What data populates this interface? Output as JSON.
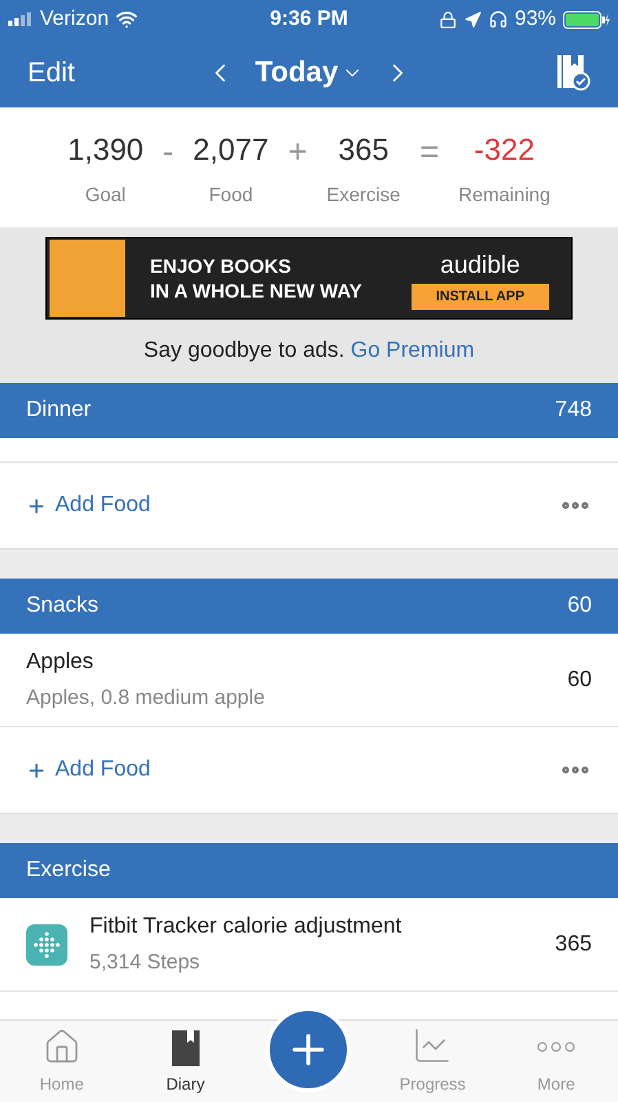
{
  "status_bar": {
    "carrier": "Verizon",
    "time": "9:36 PM",
    "battery": "93%"
  },
  "nav": {
    "edit": "Edit",
    "title": "Today"
  },
  "summary": {
    "columns": [
      {
        "value": "1,390",
        "label": "Goal",
        "kind": "term"
      },
      {
        "value": "2,077",
        "label": "Food",
        "kind": "term"
      },
      {
        "value": "365",
        "label": "Exercise",
        "kind": "term"
      },
      {
        "value": "-322",
        "label": "Remaining",
        "kind": "result"
      }
    ],
    "operators": [
      "-",
      "+",
      "="
    ]
  },
  "ad": {
    "headline": [
      "ENJOY BOOKS",
      "IN A WHOLE NEW WAY"
    ],
    "brand": "audible",
    "button": "INSTALL APP"
  },
  "premium": {
    "text": "Say goodbye to ads.",
    "link": "Go Premium"
  },
  "sections": [
    {
      "title": "Dinner",
      "total": "748",
      "add_label": "Add Food"
    },
    {
      "title": "Snacks",
      "total": "60",
      "items": [
        {
          "name": "Apples",
          "detail": "Apples, 0.8 medium apple",
          "calories": "60",
          "kind": "food"
        }
      ],
      "add_label": "Add Food"
    },
    {
      "title": "Exercise",
      "items": [
        {
          "name": "Fitbit Tracker calorie adjustment",
          "detail": "5,314 Steps",
          "calories": "365",
          "kind": "tracker"
        }
      ]
    }
  ],
  "tabs": [
    {
      "label": "Home",
      "kind": "home",
      "selected": false
    },
    {
      "label": "Diary",
      "kind": "diary",
      "selected": true
    },
    {
      "kind": "add",
      "selected": false
    },
    {
      "label": "Progress",
      "kind": "progress",
      "selected": false
    },
    {
      "label": "More",
      "kind": "more",
      "selected": false
    }
  ]
}
